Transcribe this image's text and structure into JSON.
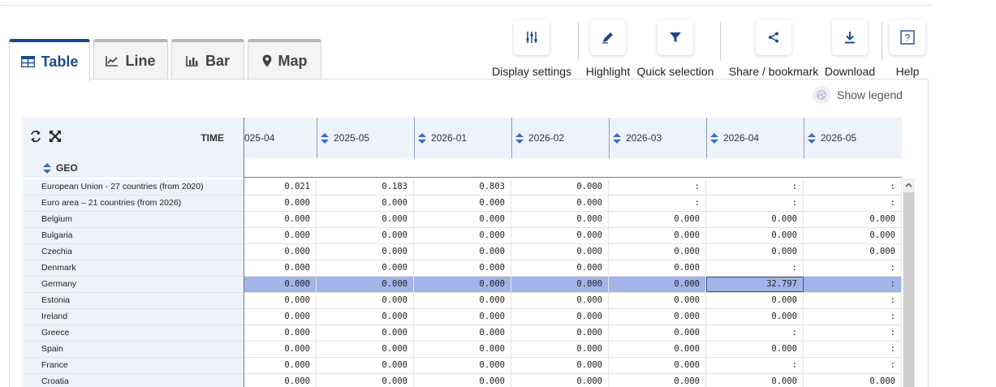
{
  "tabs": [
    {
      "label": "Table",
      "icon": "table-icon",
      "active": true
    },
    {
      "label": "Line",
      "icon": "line-chart-icon",
      "active": false
    },
    {
      "label": "Bar",
      "icon": "bar-chart-icon",
      "active": false
    },
    {
      "label": "Map",
      "icon": "map-pin-icon",
      "active": false
    }
  ],
  "toolbar": {
    "display_settings": "Display settings",
    "highlight": "Highlight",
    "quick_selection": "Quick selection",
    "share": "Share / bookmark",
    "download": "Download",
    "help": "Help"
  },
  "legend_label": "Show legend",
  "table": {
    "time_label": "TIME",
    "geo_label": "GEO",
    "columns": [
      "025-04",
      "2025-05",
      "2026-01",
      "2026-02",
      "2026-03",
      "2026-04",
      "2026-05"
    ],
    "selected_row_index": 6,
    "focused_cell": [
      6,
      5
    ],
    "rows": [
      {
        "geo": "European Union - 27 countries (from 2020)",
        "values": [
          "0.021",
          "0.183",
          "0.803",
          "0.000",
          ":",
          ":",
          ":"
        ]
      },
      {
        "geo": "Euro area – 21 countries (from 2026)",
        "values": [
          "0.000",
          "0.000",
          "0.000",
          "0.000",
          ":",
          ":",
          ":"
        ]
      },
      {
        "geo": "Belgium",
        "values": [
          "0.000",
          "0.000",
          "0.000",
          "0.000",
          "0.000",
          "0.000",
          "0.000"
        ]
      },
      {
        "geo": "Bulgaria",
        "values": [
          "0.000",
          "0.000",
          "0.000",
          "0.000",
          "0.000",
          "0.000",
          "0.000"
        ]
      },
      {
        "geo": "Czechia",
        "values": [
          "0.000",
          "0.000",
          "0.000",
          "0.000",
          "0.000",
          "0.000",
          "0.000"
        ]
      },
      {
        "geo": "Denmark",
        "values": [
          "0.000",
          "0.000",
          "0.000",
          "0.000",
          "0.000",
          ":",
          ":"
        ]
      },
      {
        "geo": "Germany",
        "values": [
          "0.000",
          "0.000",
          "0.000",
          "0.000",
          "0.000",
          "32.797",
          ":"
        ]
      },
      {
        "geo": "Estonia",
        "values": [
          "0.000",
          "0.000",
          "0.000",
          "0.000",
          "0.000",
          "0.000",
          ":"
        ]
      },
      {
        "geo": "Ireland",
        "values": [
          "0.000",
          "0.000",
          "0.000",
          "0.000",
          "0.000",
          "0.000",
          ":"
        ]
      },
      {
        "geo": "Greece",
        "values": [
          "0.000",
          "0.000",
          "0.000",
          "0.000",
          "0.000",
          ":",
          ":"
        ]
      },
      {
        "geo": "Spain",
        "values": [
          "0.000",
          "0.000",
          "0.000",
          "0.000",
          "0.000",
          "0.000",
          ":"
        ]
      },
      {
        "geo": "France",
        "values": [
          "0.000",
          "0.000",
          "0.000",
          "0.000",
          "0.000",
          ":",
          ":"
        ]
      },
      {
        "geo": "Croatia",
        "values": [
          "0.000",
          "0.000",
          "0.000",
          "0.000",
          "0.000",
          "0.000",
          "0.000"
        ]
      }
    ]
  },
  "colors": {
    "accent": "#0e47a1",
    "header_bg": "#eef2f9",
    "selected_row": "#a2b4e8"
  }
}
